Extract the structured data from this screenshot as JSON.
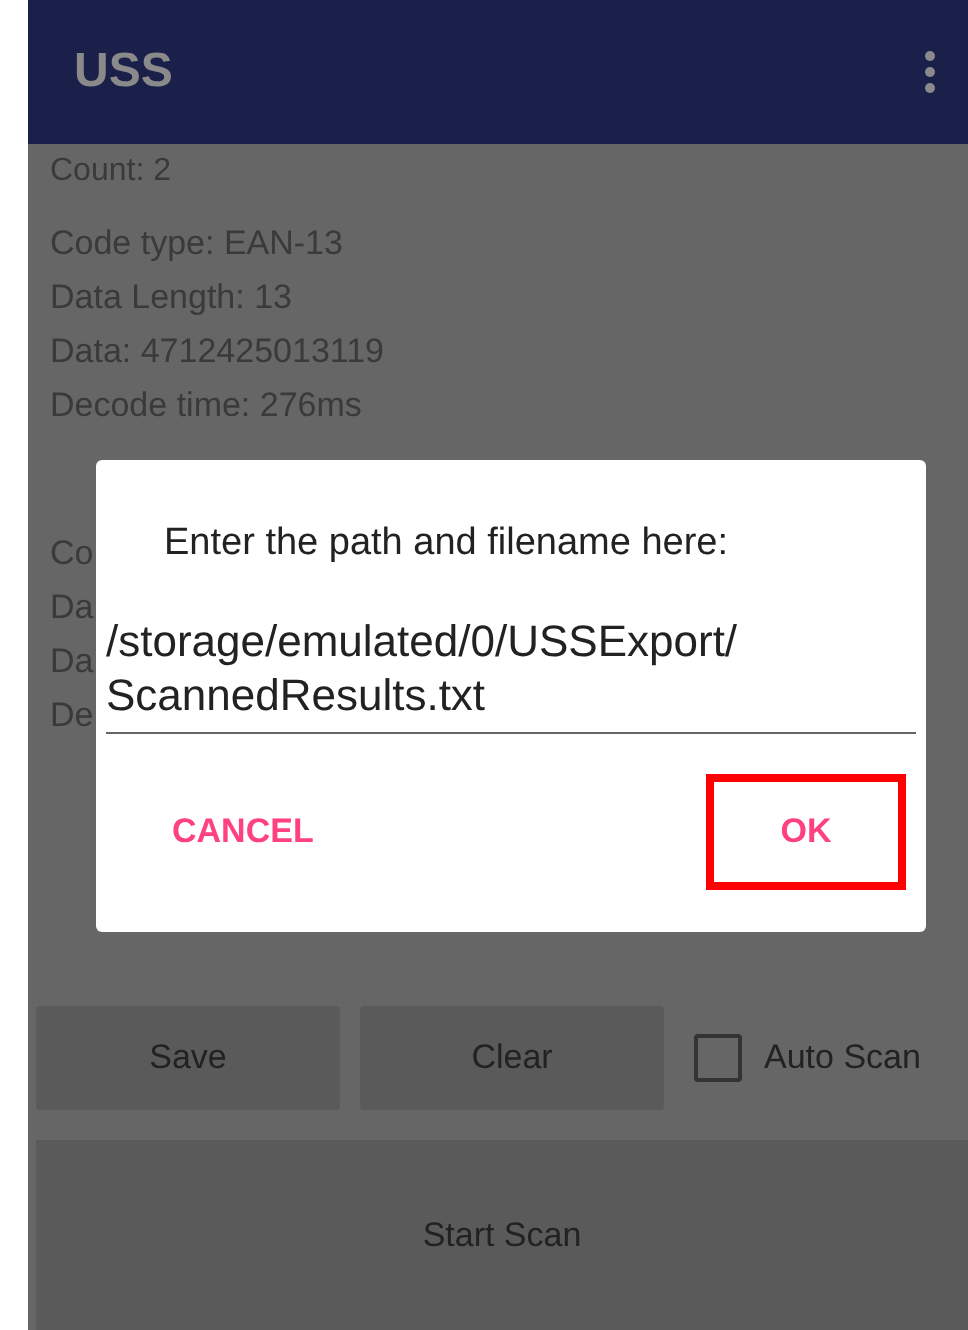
{
  "app_bar": {
    "title": "USS"
  },
  "count": "Count:  2",
  "records": [
    {
      "lines": [
        "Code type: EAN-13",
        "Data Length: 13",
        "Data: 4712425013119",
        "Decode time: 276ms"
      ]
    },
    {
      "lines": [
        "Co",
        "Da",
        "Da",
        "De"
      ]
    }
  ],
  "dialog": {
    "message": "Enter the path and filename here:",
    "value": "/storage/emulated/0/USSExport/ScannedResults.txt",
    "buttons": [
      {
        "label": "CANCEL",
        "highlighted": false
      },
      {
        "label": "OK",
        "highlighted": true
      }
    ]
  },
  "buttons": [
    "Save",
    "Clear"
  ],
  "auto_scan": {
    "label": "Auto Scan",
    "checked": false
  },
  "start_button": "Start Scan"
}
